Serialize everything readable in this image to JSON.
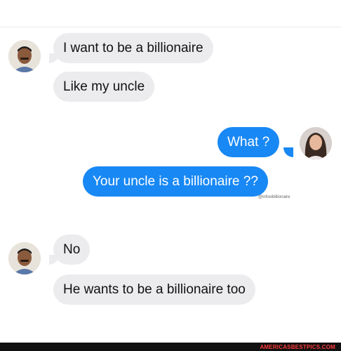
{
  "messages": [
    {
      "sender": "received",
      "text": "I want to be a billionaire"
    },
    {
      "sender": "received",
      "text": "Like my uncle"
    },
    {
      "sender": "sent",
      "text": "What ?"
    },
    {
      "sender": "sent",
      "text": "Your uncle is a billionaire ??"
    },
    {
      "sender": "received",
      "text": "No"
    },
    {
      "sender": "received",
      "text": "He wants to be a billionaire too"
    }
  ],
  "watermark": "@infoxibillionaire",
  "footer": {
    "site": "AMERICASBESTPICS.COM"
  },
  "colors": {
    "sent_bubble": "#1888f5",
    "received_bubble": "#ececef"
  },
  "avatars": {
    "received": "man-avatar",
    "sent": "woman-avatar"
  }
}
